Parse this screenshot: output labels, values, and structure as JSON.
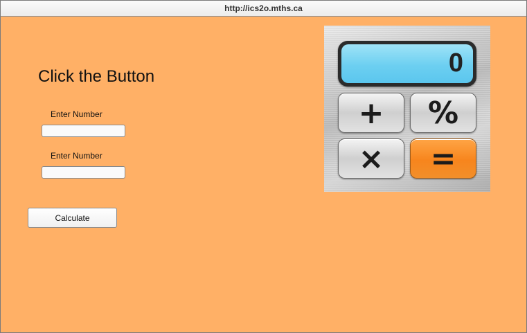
{
  "window": {
    "url": "http://ics2o.mths.ca"
  },
  "page": {
    "heading": "Click the Button",
    "field1": {
      "label": "Enter Number",
      "value": ""
    },
    "field2": {
      "label": "Enter Number",
      "value": ""
    },
    "calculate_label": "Calculate"
  },
  "calculator_image": {
    "display": "0",
    "keys": [
      "+",
      "%",
      "×",
      "="
    ],
    "accent_color": "#f7851d",
    "display_color": "#6ccff1"
  },
  "colors": {
    "background": "#ffb066"
  }
}
